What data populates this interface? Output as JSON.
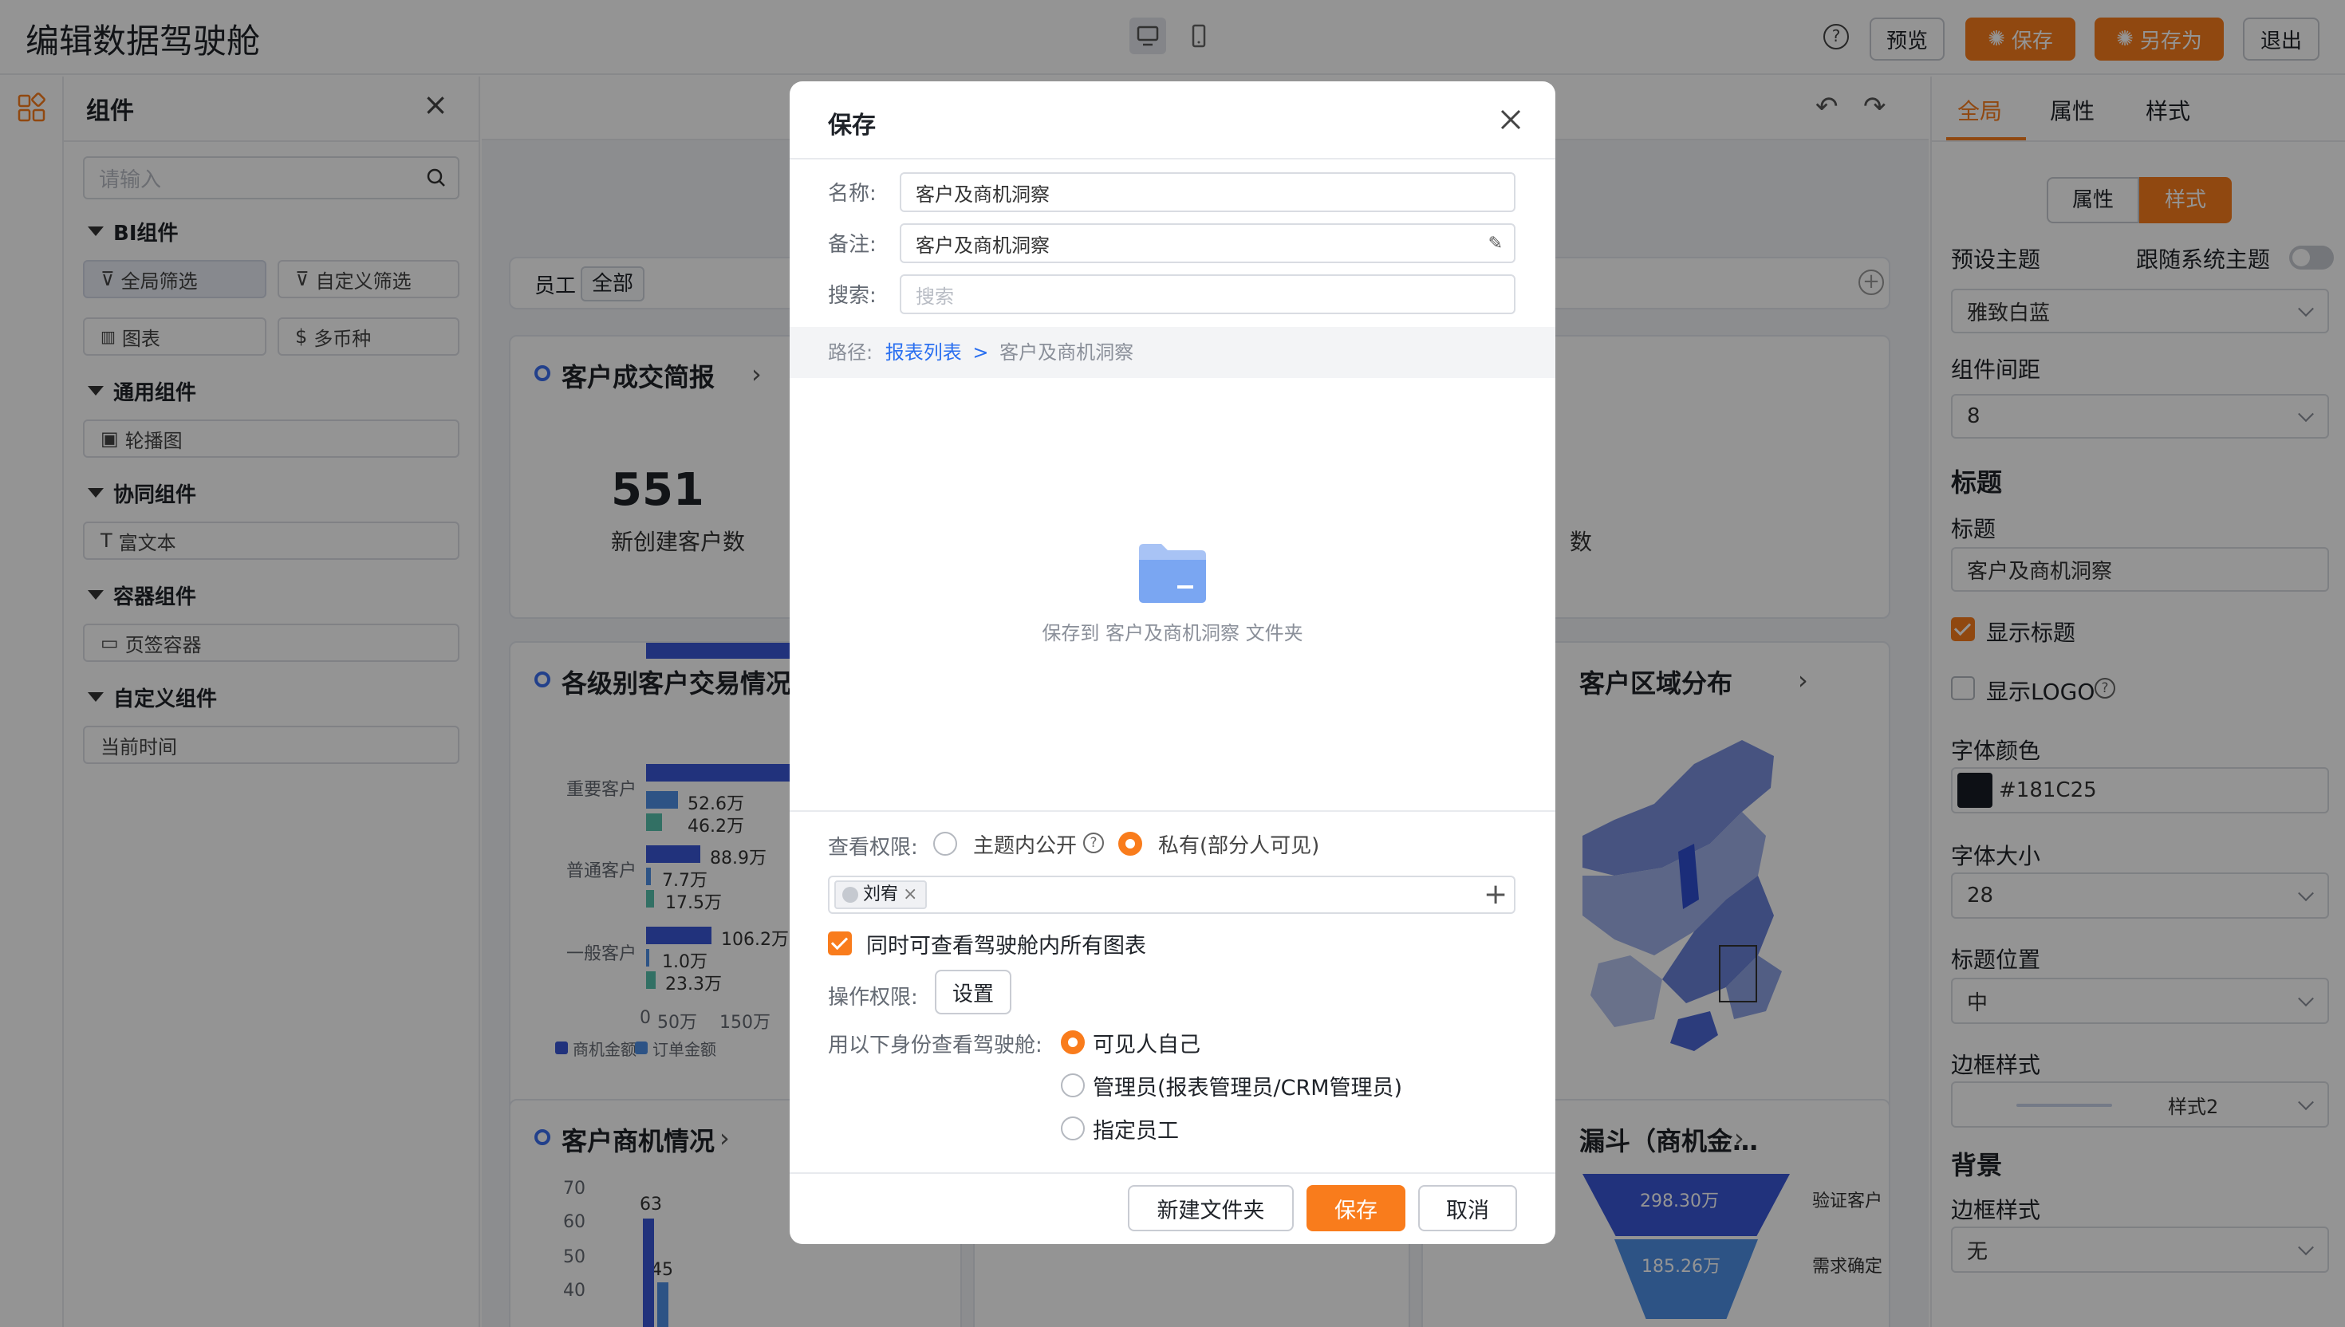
{
  "app": {
    "title": "编辑数据驾驶舱"
  },
  "header": {
    "preview": "预览",
    "save": "保存",
    "save_as": "另存为",
    "exit": "退出"
  },
  "left_panel": {
    "title": "组件",
    "search_placeholder": "请输入",
    "groups": [
      {
        "title": "BI组件",
        "items": [
          "全局筛选",
          "自定义筛选",
          "图表",
          "多币种"
        ]
      },
      {
        "title": "通用组件",
        "items": [
          "轮播图"
        ]
      },
      {
        "title": "协同组件",
        "items": [
          "富文本"
        ]
      },
      {
        "title": "容器组件",
        "items": [
          "页签容器"
        ]
      },
      {
        "title": "自定义组件",
        "items": [
          "当前时间"
        ]
      }
    ]
  },
  "canvas": {
    "filter": {
      "label": "员工",
      "value": "全部"
    },
    "card1": {
      "title": "客户成交简报",
      "kpi_value": "551",
      "kpi_label": "新创建客户数",
      "right_fragment": "数"
    },
    "card2": {
      "title": "各级别客户交易情况",
      "categories": [
        "重要客户",
        "普通客户",
        "一般客户"
      ],
      "labels": [
        [
          "52.6万",
          "46.2万"
        ],
        [
          "88.9万",
          "7.7万",
          "17.5万"
        ],
        [
          "106.2万",
          "1.0万",
          "23.3万"
        ]
      ],
      "x_ticks": [
        "0",
        "50万",
        "150万"
      ],
      "legend": [
        "商机金额",
        "订单金额"
      ]
    },
    "card3": {
      "title": "客户区域分布"
    },
    "card4": {
      "title": "客户商机情况",
      "y_ticks": [
        "70",
        "60",
        "50",
        "40"
      ],
      "bar_labels": [
        "63",
        "45"
      ]
    },
    "card5": {
      "row_label": "刘宥"
    },
    "card6": {
      "title": "漏斗（商机金…",
      "stages": [
        {
          "value": "298.30万",
          "label": "验证客户"
        },
        {
          "value": "185.26万",
          "label": "需求确定"
        }
      ]
    }
  },
  "right_panel": {
    "tabs": [
      "全局",
      "属性",
      "样式"
    ],
    "subtabs": [
      "属性",
      "样式"
    ],
    "preset_theme_label": "预设主题",
    "follow_system_label": "跟随系统主题",
    "preset_theme_value": "雅致白蓝",
    "spacing_label": "组件间距",
    "spacing_value": "8",
    "title_section": "标题",
    "title_label": "标题",
    "title_value": "客户及商机洞察",
    "show_title": "显示标题",
    "show_logo": "显示LOGO",
    "font_color_label": "字体颜色",
    "font_color_value": "#181C25",
    "font_size_label": "字体大小",
    "font_size_value": "28",
    "title_pos_label": "标题位置",
    "title_pos_value": "中",
    "border_style_label": "边框样式",
    "border_style_value": "样式2",
    "bg_section": "背景",
    "bg_border_label": "边框样式",
    "bg_border_value": "无"
  },
  "dialog": {
    "title": "保存",
    "name_label": "名称:",
    "name_value": "客户及商机洞察",
    "note_label": "备注:",
    "note_value": "客户及商机洞察",
    "search_label": "搜索:",
    "search_placeholder": "搜索",
    "path_label": "路径:",
    "path_link": "报表列表",
    "path_sep": ">",
    "path_current": "客户及商机洞察",
    "folder_text": "保存到 客户及商机洞察 文件夹",
    "view_perm_label": "查看权限:",
    "perm_public": "主题内公开",
    "perm_private": "私有(部分人可见)",
    "user_tag": "刘宥",
    "view_all_charts": "同时可查看驾驶舱内所有图表",
    "op_perm_label": "操作权限:",
    "op_perm_button": "设置",
    "identity_label": "用以下身份查看驾驶舱:",
    "identity_options": [
      "可见人自己",
      "管理员(报表管理员/CRM管理员)",
      "指定员工"
    ],
    "new_folder": "新建文件夹",
    "save": "保存",
    "cancel": "取消"
  },
  "colors": {
    "accent": "#f97c1c",
    "bar_blue": "#3a57d6",
    "bar_teal": "#56c2ad",
    "link": "#2a6ff0",
    "overlay": "rgba(0,0,0,0.45)"
  }
}
